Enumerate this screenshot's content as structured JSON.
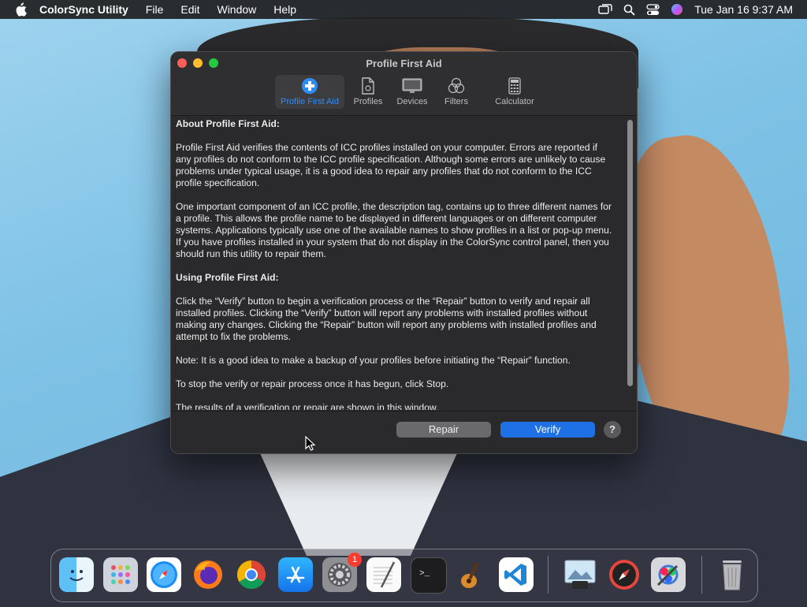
{
  "menubar": {
    "app_name": "ColorSync Utility",
    "items": [
      "File",
      "Edit",
      "Window",
      "Help"
    ],
    "clock": "Tue Jan 16  9:37 AM"
  },
  "window": {
    "title": "Profile First Aid",
    "tabs": [
      {
        "label": "Profile First Aid",
        "icon": "first-aid-icon",
        "active": true
      },
      {
        "label": "Profiles",
        "icon": "document-icon",
        "active": false
      },
      {
        "label": "Devices",
        "icon": "display-icon",
        "active": false
      },
      {
        "label": "Filters",
        "icon": "filter-icon",
        "active": false
      },
      {
        "label": "Calculator",
        "icon": "calculator-icon",
        "active": false
      }
    ],
    "content": {
      "heading1": "About Profile First Aid:",
      "para1": "Profile First Aid verifies the contents of ICC profiles installed on your computer. Errors are reported if any profiles do not conform to the ICC profile specification. Although some errors are unlikely to cause problems under typical usage, it is a good idea to repair any profiles that do not conform to the ICC profile specification.",
      "para2": "One important component of an ICC profile, the description tag, contains up to three different names for a profile. This allows the profile name to be displayed in different languages or on different computer systems. Applications typically use one of the available names to show profiles in a list or pop-up menu. If you have profiles installed in your system that do not display in the ColorSync control panel, then you should run this utility to repair them.",
      "heading2": "Using Profile First Aid:",
      "para3": "Click the “Verify” button to begin a verification process or the “Repair” button to verify and repair all installed profiles. Clicking the “Verify” button will report any problems with installed profiles without making any changes. Clicking the “Repair” button will report any problems with installed profiles and attempt to fix the problems.",
      "para4": "Note: It is a good idea to make a backup of your profiles before initiating the “Repair” function.",
      "para5": "To stop the verify or repair process once it has begun, click Stop.",
      "para6": "The results of a verification or repair are shown in this window."
    },
    "buttons": {
      "repair": "Repair",
      "verify": "Verify",
      "help": "?"
    }
  },
  "dock": {
    "apps": [
      "Finder",
      "Launchpad",
      "Safari",
      "Firefox",
      "Chrome",
      "App Store",
      "System Settings",
      "TextEdit",
      "Terminal",
      "GarageBand",
      "Visual Studio Code",
      "Preview",
      "Compass",
      "ColorSync Utility",
      "Trash"
    ],
    "settings_badge": "1"
  },
  "colors": {
    "accent": "#1f6fe5",
    "active_tab_text": "#2f8cf5",
    "window_bg": "#2a2a2c"
  }
}
